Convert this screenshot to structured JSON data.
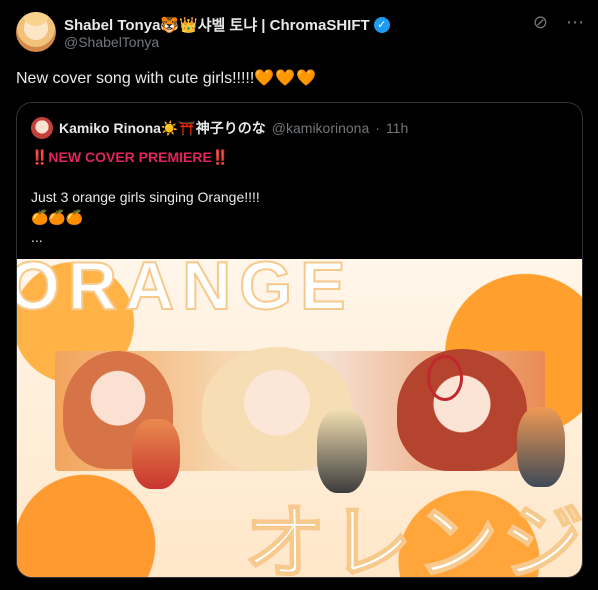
{
  "author": {
    "display_name": "Shabel Tonya🐯👑샤벨 토냐 | ChromaSHIFT",
    "handle": "@ShabelTonya",
    "verified": true
  },
  "tweet": {
    "text": "New cover song with cute girls!!!!!",
    "emoji_suffix": "🧡🧡🧡"
  },
  "top_icons": [
    "grok-icon",
    "more-icon"
  ],
  "quote": {
    "display_name": "Kamiko Rinona☀️⛩️神子りのな",
    "handle": "@kamikorinona",
    "separator": "·",
    "time": "11h",
    "lines": [
      "‼️NEW COVER PREMIERE‼️",
      "",
      "Just 3 orange girls singing Orange!!!!",
      "🍊🍊🍊",
      "..."
    ],
    "media": {
      "title_en": "ORANGE",
      "title_jp": "オレンジ"
    }
  },
  "colors": {
    "background": "#000000",
    "text": "#e7e9ea",
    "muted": "#71767b",
    "verified": "#1d9bf0",
    "accent_orange": "#f4900c"
  }
}
